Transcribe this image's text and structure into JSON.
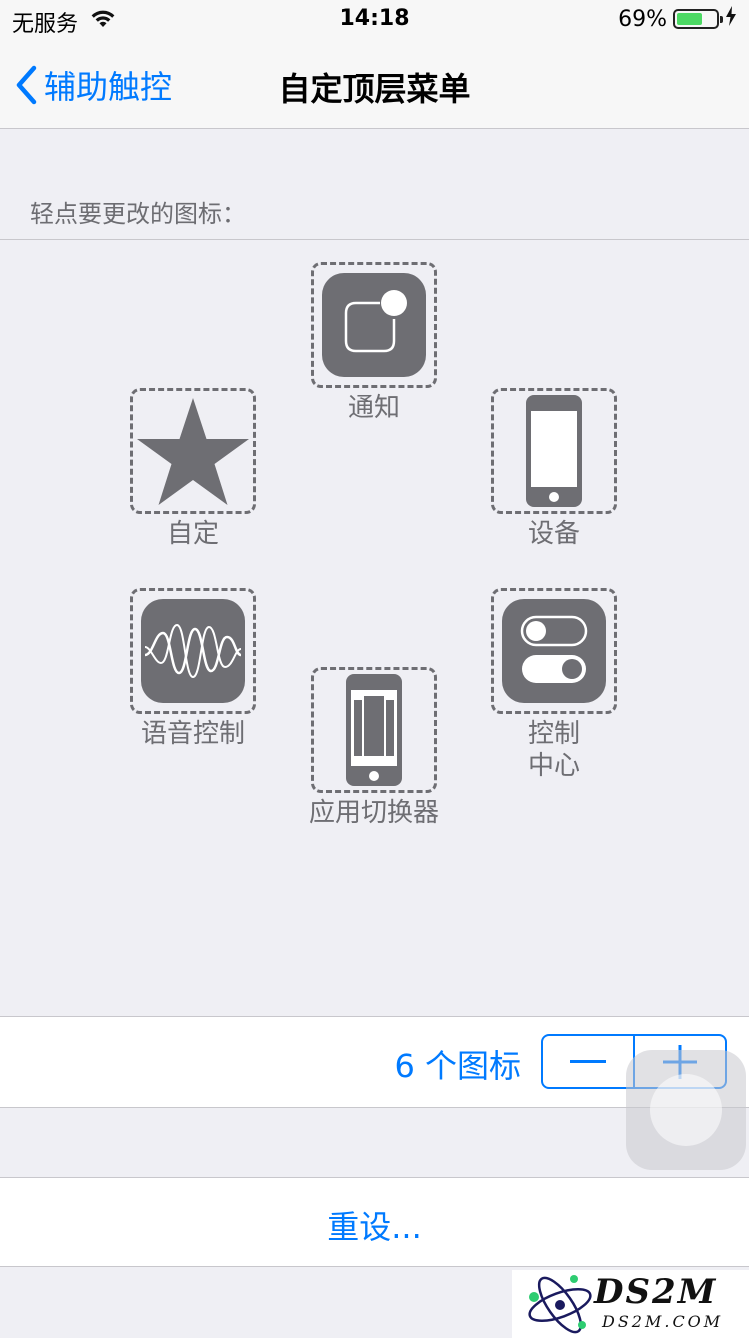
{
  "status_bar": {
    "carrier": "无服务",
    "time": "14:18",
    "battery_percent": "69%",
    "battery_level": 0.69,
    "battery_color": "#4cd964",
    "icons": [
      "wifi-icon",
      "battery-icon",
      "charging-bolt-icon"
    ]
  },
  "nav": {
    "back_label": "辅助触控",
    "title": "自定顶层菜单"
  },
  "section_header": "轻点要更改的图标：",
  "menu_items": [
    {
      "label": "通知",
      "icon": "notification-icon"
    },
    {
      "label": "自定",
      "icon": "star-icon"
    },
    {
      "label": "设备",
      "icon": "device-icon"
    },
    {
      "label": "语音控制",
      "icon": "voice-control-icon"
    },
    {
      "label": "应用切换器",
      "icon": "app-switcher-icon"
    },
    {
      "label": "控制\n中心",
      "icon": "control-center-icon"
    }
  ],
  "icon_count": {
    "label": "6 个图标",
    "decrement_icon": "minus-icon",
    "increment_icon": "plus-icon"
  },
  "reset_label": "重设...",
  "watermark": {
    "title": "DS2M",
    "subtitle": "DS2M.COM"
  },
  "colors": {
    "accent": "#007aff",
    "icon_gray": "#6e6e73",
    "background": "#efeff4"
  }
}
